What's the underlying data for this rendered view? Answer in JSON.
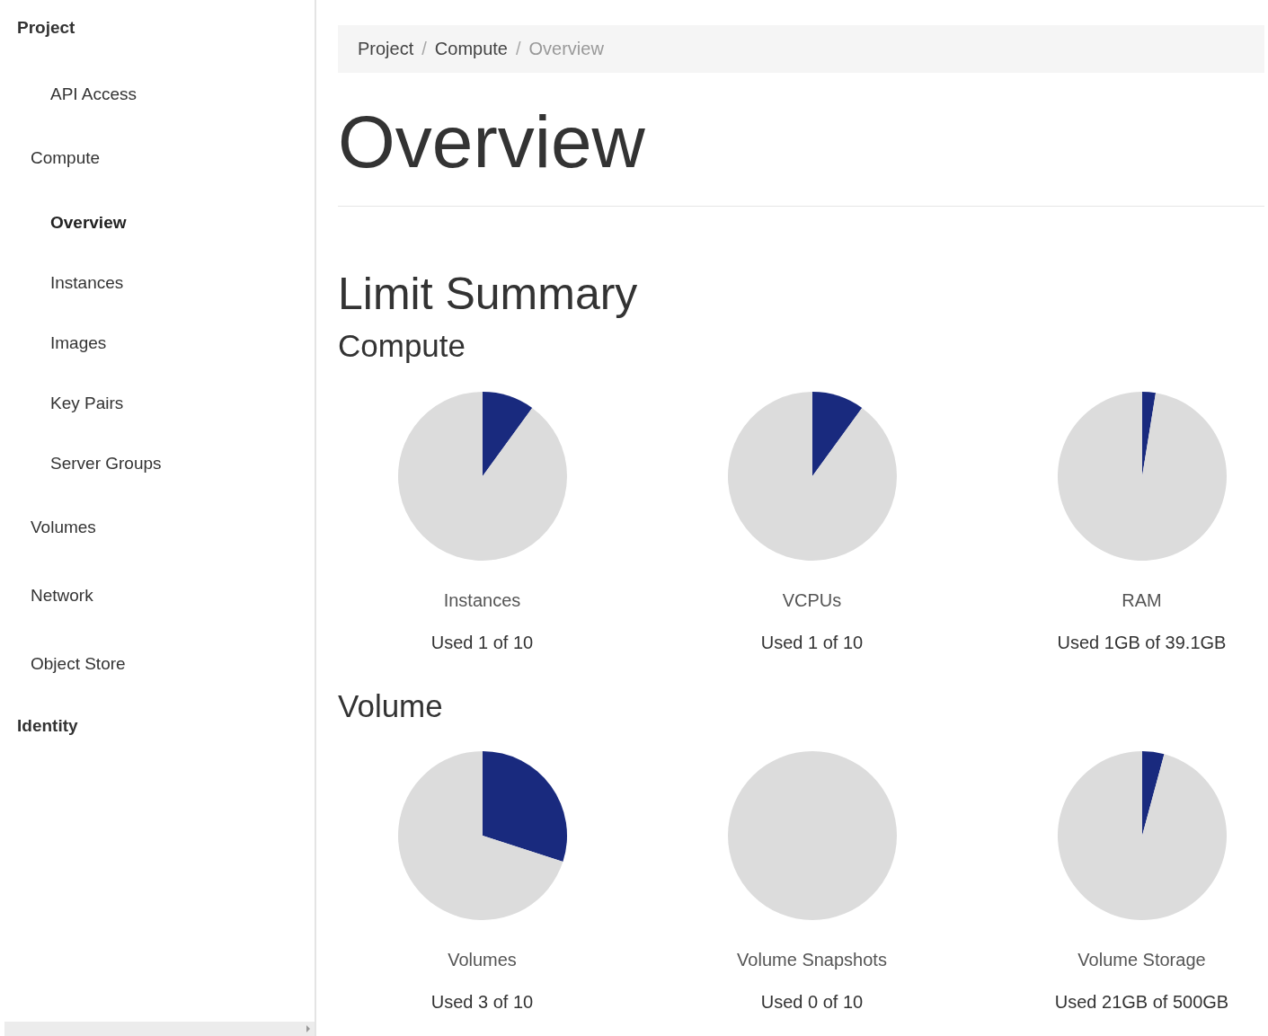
{
  "sidebar": {
    "items": [
      {
        "label": "Project",
        "kind": "heading",
        "selected": false,
        "children": [
          {
            "label": "API Access",
            "kind": "link",
            "selected": false
          },
          {
            "label": "Compute",
            "kind": "section",
            "selected": false,
            "children": [
              {
                "label": "Overview",
                "kind": "link",
                "selected": true
              },
              {
                "label": "Instances",
                "kind": "link",
                "selected": false
              },
              {
                "label": "Images",
                "kind": "link",
                "selected": false
              },
              {
                "label": "Key Pairs",
                "kind": "link",
                "selected": false
              },
              {
                "label": "Server Groups",
                "kind": "link",
                "selected": false
              }
            ]
          },
          {
            "label": "Volumes",
            "kind": "section",
            "selected": false
          },
          {
            "label": "Network",
            "kind": "section",
            "selected": false
          },
          {
            "label": "Object Store",
            "kind": "section",
            "selected": false
          }
        ]
      },
      {
        "label": "Identity",
        "kind": "heading",
        "selected": false
      }
    ]
  },
  "breadcrumb": [
    {
      "label": "Project",
      "current": false
    },
    {
      "separator": "/",
      "label": "Compute",
      "current": false
    },
    {
      "separator": "/",
      "label": "Overview",
      "current": true
    }
  ],
  "page_title": "Overview",
  "section_title": "Limit Summary",
  "groups": [
    {
      "title": "Compute",
      "quotas": [
        {
          "name": "Instances",
          "usage": "Used 1 of 10",
          "chart_data": {
            "type": "pie",
            "values": [
              10,
              90
            ]
          }
        },
        {
          "name": "VCPUs",
          "usage": "Used 1 of 10",
          "chart_data": {
            "type": "pie",
            "values": [
              10,
              90
            ]
          }
        },
        {
          "name": "RAM",
          "usage": "Used 1GB of 39.1GB",
          "chart_data": {
            "type": "pie",
            "values": [
              2.56,
              97.44
            ]
          }
        }
      ]
    },
    {
      "title": "Volume",
      "quotas": [
        {
          "name": "Volumes",
          "usage": "Used 3 of 10",
          "chart_data": {
            "type": "pie",
            "values": [
              30,
              70
            ]
          }
        },
        {
          "name": "Volume Snapshots",
          "usage": "Used 0 of 10",
          "chart_data": {
            "type": "pie",
            "values": [
              0,
              100
            ]
          }
        },
        {
          "name": "Volume Storage",
          "usage": "Used 21GB of 500GB",
          "chart_data": {
            "type": "pie",
            "values": [
              4.2,
              95.8
            ]
          }
        }
      ]
    }
  ]
}
